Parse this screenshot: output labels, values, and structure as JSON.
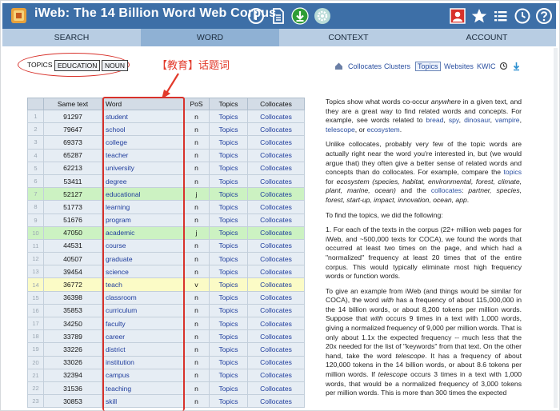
{
  "header": {
    "title": "iWeb: The 14 Billion Word Web Corpus",
    "colors": {
      "bar": "#3d6fa7",
      "accent_red": "#d8322b",
      "green_icon": "#2e9d35"
    }
  },
  "nav": {
    "tabs": [
      {
        "label": "SEARCH"
      },
      {
        "label": "WORD"
      },
      {
        "label": "CONTEXT"
      },
      {
        "label": "ACCOUNT"
      }
    ]
  },
  "topics_bar": {
    "label": "TOPICS",
    "pills": [
      "EDUCATION",
      "NOUN"
    ],
    "annotation": "【教育】话题词"
  },
  "right_tools": {
    "items": [
      "Collocates",
      "Clusters",
      "Topics",
      "Websites",
      "KWIC"
    ],
    "active": "Topics"
  },
  "table": {
    "headers": [
      "",
      "Same text",
      "Word",
      "PoS",
      "Topics",
      "Collocates"
    ],
    "rows": [
      {
        "n": "1",
        "freq": "91297",
        "word": "student",
        "pos": "n",
        "topics": "Topics",
        "coll": "Collocates",
        "hl": ""
      },
      {
        "n": "2",
        "freq": "79647",
        "word": "school",
        "pos": "n",
        "topics": "Topics",
        "coll": "Collocates",
        "hl": ""
      },
      {
        "n": "3",
        "freq": "69373",
        "word": "college",
        "pos": "n",
        "topics": "Topics",
        "coll": "Collocates",
        "hl": ""
      },
      {
        "n": "4",
        "freq": "65287",
        "word": "teacher",
        "pos": "n",
        "topics": "Topics",
        "coll": "Collocates",
        "hl": ""
      },
      {
        "n": "5",
        "freq": "62213",
        "word": "university",
        "pos": "n",
        "topics": "Topics",
        "coll": "Collocates",
        "hl": ""
      },
      {
        "n": "6",
        "freq": "53411",
        "word": "degree",
        "pos": "n",
        "topics": "Topics",
        "coll": "Collocates",
        "hl": ""
      },
      {
        "n": "7",
        "freq": "52127",
        "word": "educational",
        "pos": "j",
        "topics": "Topics",
        "coll": "Collocates",
        "hl": "green"
      },
      {
        "n": "8",
        "freq": "51773",
        "word": "learning",
        "pos": "n",
        "topics": "Topics",
        "coll": "Collocates",
        "hl": ""
      },
      {
        "n": "9",
        "freq": "51676",
        "word": "program",
        "pos": "n",
        "topics": "Topics",
        "coll": "Collocates",
        "hl": ""
      },
      {
        "n": "10",
        "freq": "47050",
        "word": "academic",
        "pos": "j",
        "topics": "Topics",
        "coll": "Collocates",
        "hl": "green"
      },
      {
        "n": "11",
        "freq": "44531",
        "word": "course",
        "pos": "n",
        "topics": "Topics",
        "coll": "Collocates",
        "hl": ""
      },
      {
        "n": "12",
        "freq": "40507",
        "word": "graduate",
        "pos": "n",
        "topics": "Topics",
        "coll": "Collocates",
        "hl": ""
      },
      {
        "n": "13",
        "freq": "39454",
        "word": "science",
        "pos": "n",
        "topics": "Topics",
        "coll": "Collocates",
        "hl": ""
      },
      {
        "n": "14",
        "freq": "36772",
        "word": "teach",
        "pos": "v",
        "topics": "Topics",
        "coll": "Collocates",
        "hl": "yellow"
      },
      {
        "n": "15",
        "freq": "36398",
        "word": "classroom",
        "pos": "n",
        "topics": "Topics",
        "coll": "Collocates",
        "hl": ""
      },
      {
        "n": "16",
        "freq": "35853",
        "word": "curriculum",
        "pos": "n",
        "topics": "Topics",
        "coll": "Collocates",
        "hl": ""
      },
      {
        "n": "17",
        "freq": "34250",
        "word": "faculty",
        "pos": "n",
        "topics": "Topics",
        "coll": "Collocates",
        "hl": ""
      },
      {
        "n": "18",
        "freq": "33789",
        "word": "career",
        "pos": "n",
        "topics": "Topics",
        "coll": "Collocates",
        "hl": ""
      },
      {
        "n": "19",
        "freq": "33226",
        "word": "district",
        "pos": "n",
        "topics": "Topics",
        "coll": "Collocates",
        "hl": ""
      },
      {
        "n": "20",
        "freq": "33026",
        "word": "institution",
        "pos": "n",
        "topics": "Topics",
        "coll": "Collocates",
        "hl": ""
      },
      {
        "n": "21",
        "freq": "32394",
        "word": "campus",
        "pos": "n",
        "topics": "Topics",
        "coll": "Collocates",
        "hl": ""
      },
      {
        "n": "22",
        "freq": "31536",
        "word": "teaching",
        "pos": "n",
        "topics": "Topics",
        "coll": "Collocates",
        "hl": ""
      },
      {
        "n": "23",
        "freq": "30853",
        "word": "skill",
        "pos": "n",
        "topics": "Topics",
        "coll": "Collocates",
        "hl": ""
      }
    ]
  },
  "explanation": {
    "p1": [
      {
        "t": "Topics show what words co-occur "
      },
      {
        "t": "anywhere",
        "em": true
      },
      {
        "t": " in a given text, and they are a great way to find related words and concepts. For example, see words related to "
      },
      {
        "t": "bread",
        "link": true
      },
      {
        "t": ", "
      },
      {
        "t": "spy",
        "link": true
      },
      {
        "t": ", "
      },
      {
        "t": "dinosaur",
        "link": true
      },
      {
        "t": ", "
      },
      {
        "t": "vampire",
        "link": true
      },
      {
        "t": ", "
      },
      {
        "t": "telescope",
        "link": true
      },
      {
        "t": ", or "
      },
      {
        "t": "ecosystem",
        "link": true
      },
      {
        "t": "."
      }
    ],
    "p2": [
      {
        "t": "Unlike collocates, probably very few of the topic words are actually right near the word you're interested in, but (we would argue that) they often give a better sense of related words and concepts than do collocates. For example, compare the "
      },
      {
        "t": "topics",
        "link": true
      },
      {
        "t": " for "
      },
      {
        "t": "ecosystem (species, habitat, environmental, forest, climate, plant, marine, ocean)",
        "em": true
      },
      {
        "t": " and the "
      },
      {
        "t": "collocates",
        "link": true
      },
      {
        "t": ": "
      },
      {
        "t": "partner, species, forest, start-up, impact, innovation, ocean, app",
        "em": true
      },
      {
        "t": "."
      }
    ],
    "p3": [
      {
        "t": "To find the topics, we did the following:"
      }
    ],
    "p4": [
      {
        "t": "1. For each of the texts in the corpus (22+ million web pages for iWeb, and ~500,000 texts for COCA), we found the words that occurred at least two times on the page, and which had a \"normalized\" frequency at least 20 times that of the entire corpus. This would typically eliminate most high frequency words or function words."
      }
    ],
    "p5": [
      {
        "t": "To give an example from iWeb (and things would be similar for COCA), the word "
      },
      {
        "t": "with",
        "em": true
      },
      {
        "t": " has a frequency of about 115,000,000 in the 14 billion words, or about 8,200 tokens per million words. Suppose that "
      },
      {
        "t": "with",
        "em": true
      },
      {
        "t": " occurs 9 times in a text with 1,000 words, giving a normalized frequency of 9,000 per million words. That is only about 1.1x the expected frequency -- much less that the 20x needed for the list of \"keywords\" from that text. On the other hand, take the word "
      },
      {
        "t": "telescope",
        "em": true
      },
      {
        "t": ". It has a frequency of about 120,000 tokens in the 14 billion words, or about 8.6 tokens per million words. If "
      },
      {
        "t": "telescope",
        "em": true
      },
      {
        "t": " occurs 3 times in a text with 1,000 words, that would be a normalized frequency of 3,000 tokens per million words. This is more than 300 times the expected"
      }
    ]
  }
}
